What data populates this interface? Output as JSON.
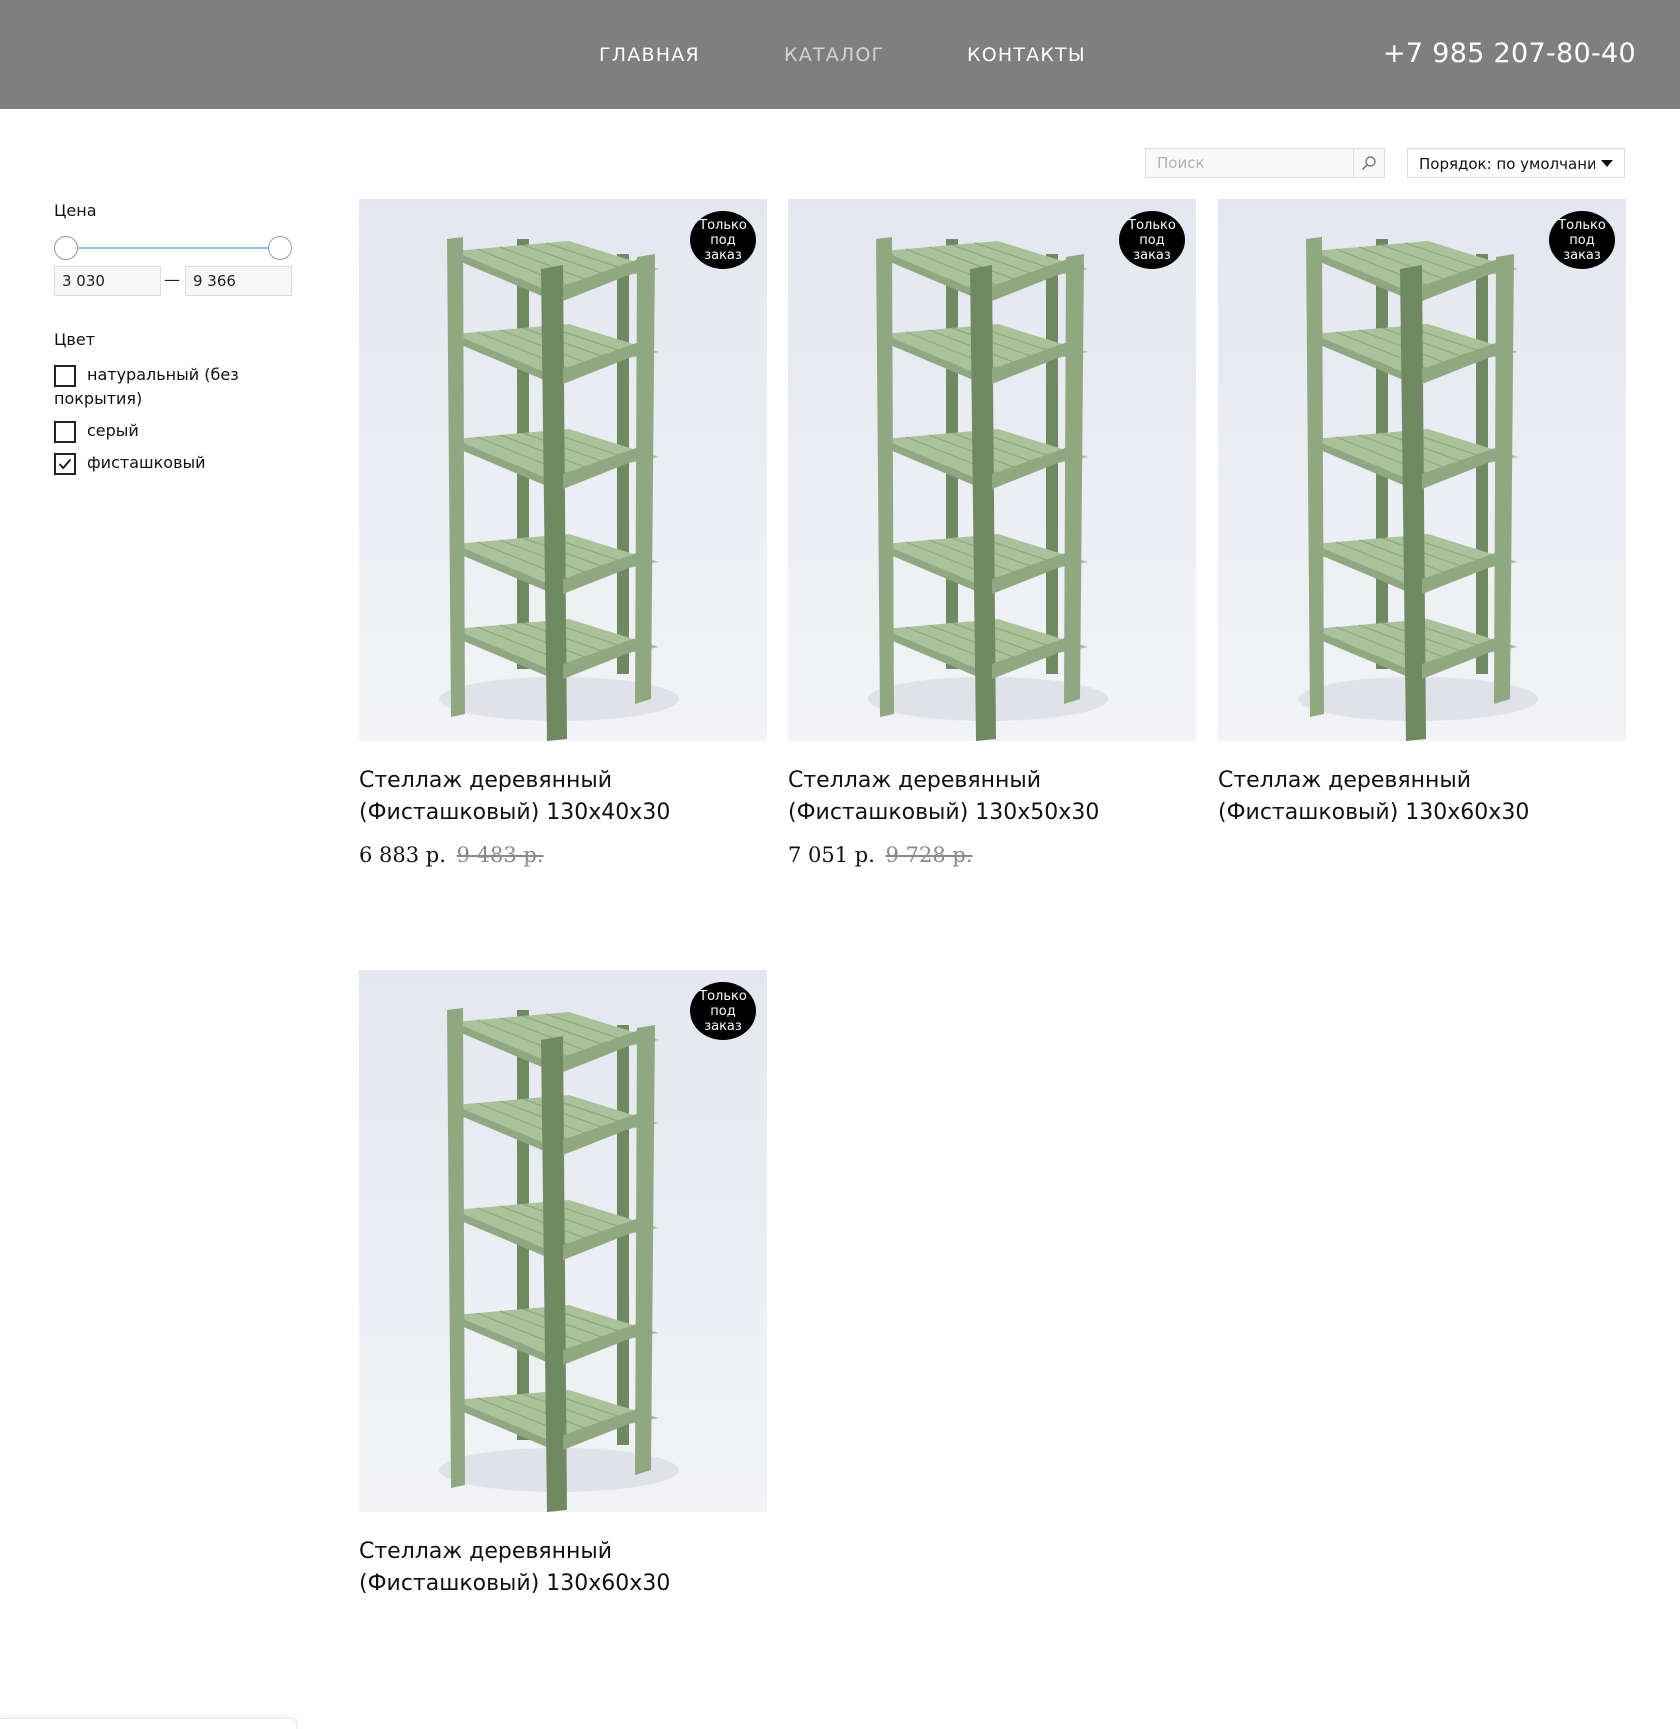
{
  "header": {
    "nav": [
      "ГЛАВНАЯ",
      "КАТАЛОГ",
      "КОНТАКТЫ"
    ],
    "active_nav": "КАТАЛОГ",
    "phone": "+7 985 207-80-40",
    "background_color": "#7f7f7f"
  },
  "search": {
    "placeholder": "Поиск",
    "value": "",
    "button_icon": "search-icon"
  },
  "sort": {
    "selected": "Порядок: по умолчанию",
    "icon": "caret-down-icon"
  },
  "filters": {
    "price": {
      "title": "Цена",
      "min": "3 030",
      "max": "9 366",
      "dash": "—"
    },
    "color": {
      "title": "Цвет",
      "options": [
        {
          "label": "натуральный (без покрытия)",
          "checked": false
        },
        {
          "label": "серый",
          "checked": false
        },
        {
          "label": "фисташковый",
          "checked": true
        }
      ]
    }
  },
  "products": [
    {
      "title": "Стеллаж деревянный (Фисташковый) 130х40х30",
      "badge": "Только под заказ",
      "price": "6 883 р.",
      "old_price": "9 483 р."
    },
    {
      "title": "Стеллаж деревянный (Фисташковый) 130х50х30",
      "badge": "Только под заказ",
      "price": "7 051 р.",
      "old_price": "9 728 р."
    },
    {
      "title": "Стеллаж деревянный (Фисташковый) 130х60х30",
      "badge": "Только под заказ",
      "price": "",
      "old_price": ""
    },
    {
      "title": "Стеллаж деревянный (Фисташковый) 130х60х30",
      "badge": "Только под заказ",
      "price": "",
      "old_price": ""
    }
  ],
  "colors": {
    "shelf": "#8fa882",
    "shelf_dark": "#6f8a63",
    "shelf_light": "#a9c29b",
    "slider_track": "#8dc7ee",
    "badge": "#000000"
  }
}
